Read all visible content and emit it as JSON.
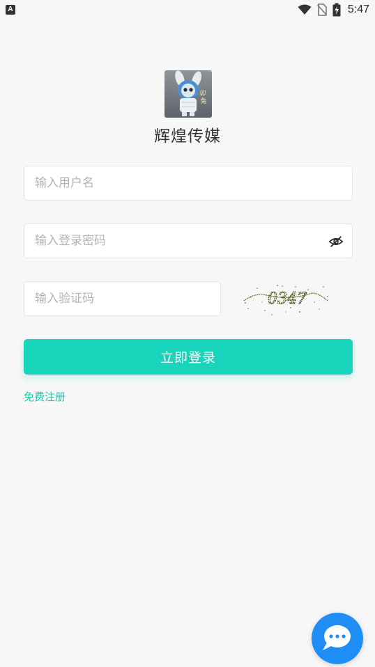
{
  "status_bar": {
    "app_indicator": "A",
    "time": "5:47",
    "icons": [
      "wifi-icon",
      "no-sim-icon",
      "battery-charging-icon"
    ]
  },
  "brand": {
    "title": "辉煌传媒",
    "logo": "bunny-avatar-logo"
  },
  "form": {
    "username_placeholder": "输入用户名",
    "password_placeholder": "输入登录密码",
    "captcha_placeholder": "输入验证码",
    "captcha_text": "0347",
    "submit_label": "立即登录",
    "register_label": "免费注册"
  },
  "chat": {
    "icon": "chat-bubble-icon"
  },
  "colors": {
    "accent": "#18d4ba",
    "link": "#18c9b0",
    "chat_button": "#1e8ef5",
    "background": "#f7f7f8"
  }
}
